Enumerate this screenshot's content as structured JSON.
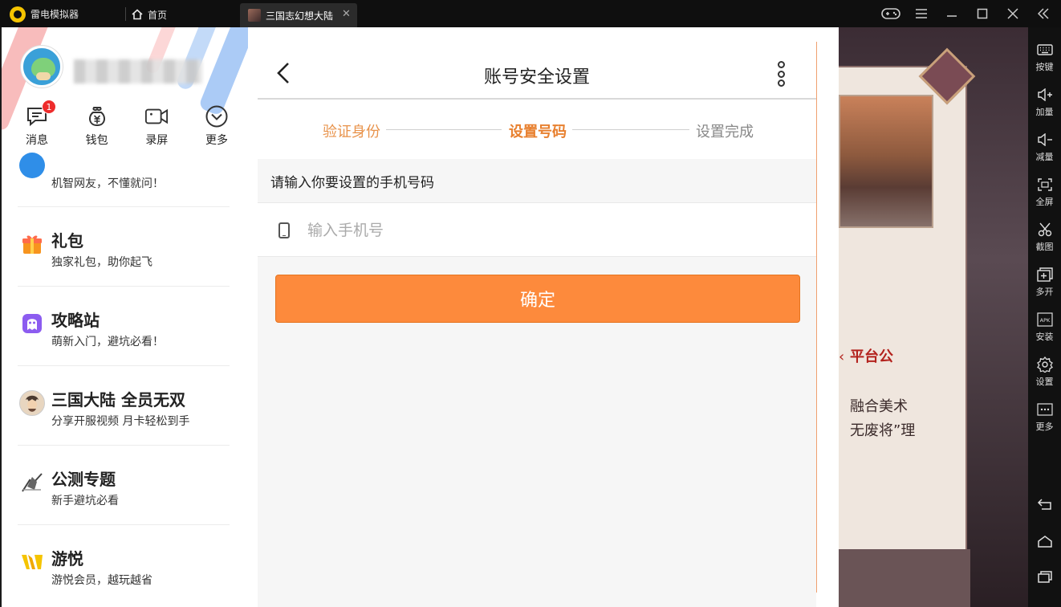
{
  "titlebar": {
    "app_name": "雷电模拟器",
    "home_tab": "首页",
    "game_tab": "三国志幻想大陆",
    "close_glyph": "✕"
  },
  "sidebar": {
    "quick_actions": [
      {
        "label": "消息",
        "icon": "message-icon",
        "badge": "1"
      },
      {
        "label": "钱包",
        "icon": "wallet-icon"
      },
      {
        "label": "录屏",
        "icon": "record-icon"
      },
      {
        "label": "更多",
        "icon": "more-circle-icon"
      }
    ],
    "items": [
      {
        "title": "",
        "subtitle": "机智网友，不懂就问！",
        "icon": "qa-icon",
        "color": "#2f8ee8"
      },
      {
        "title": "礼包",
        "subtitle": "独家礼包，助你起飞",
        "icon": "gift-icon",
        "color": "#f7941e"
      },
      {
        "title": "攻略站",
        "subtitle": "萌新入门，避坑必看！",
        "icon": "guide-icon",
        "color": "#8c5cf0"
      },
      {
        "title": "三国大陆 全员无双",
        "subtitle": "分享开服视频 月卡轻松到手",
        "icon": "game-avatar-icon",
        "color": "#7a6a5a"
      },
      {
        "title": "公测专题",
        "subtitle": "新手避坑必看",
        "icon": "warrior-icon",
        "color": "#5a5a5a"
      },
      {
        "title": "游悦",
        "subtitle": "游悦会员，越玩越省",
        "icon": "crown-icon",
        "color": "#f0b400"
      }
    ]
  },
  "page": {
    "title": "账号安全设置",
    "steps": [
      "验证身份",
      "设置号码",
      "设置完成"
    ],
    "prompt": "请输入你要设置的手机号码",
    "phone_placeholder": "输入手机号",
    "phone_value": "",
    "confirm_label": "确定"
  },
  "game": {
    "text1": "平台公",
    "text2": "融合美术",
    "text3": "无废将”理",
    "arrow": "‹"
  },
  "toolbar": {
    "items": [
      {
        "label": "按键",
        "icon": "keyboard-icon"
      },
      {
        "label": "加量",
        "icon": "volume-up-icon"
      },
      {
        "label": "减量",
        "icon": "volume-down-icon"
      },
      {
        "label": "全屏",
        "icon": "fullscreen-icon"
      },
      {
        "label": "截图",
        "icon": "scissors-icon"
      },
      {
        "label": "多开",
        "icon": "multi-instance-icon"
      },
      {
        "label": "安装",
        "icon": "apk-install-icon"
      },
      {
        "label": "设置",
        "icon": "settings-gear-icon"
      },
      {
        "label": "更多",
        "icon": "more-dots-icon"
      }
    ]
  },
  "colors": {
    "accent": "#fd8a3c",
    "step_active": "#e8802f",
    "step_done": "#e8924a",
    "step_pending": "#888888",
    "badge": "#ee2c2c"
  }
}
